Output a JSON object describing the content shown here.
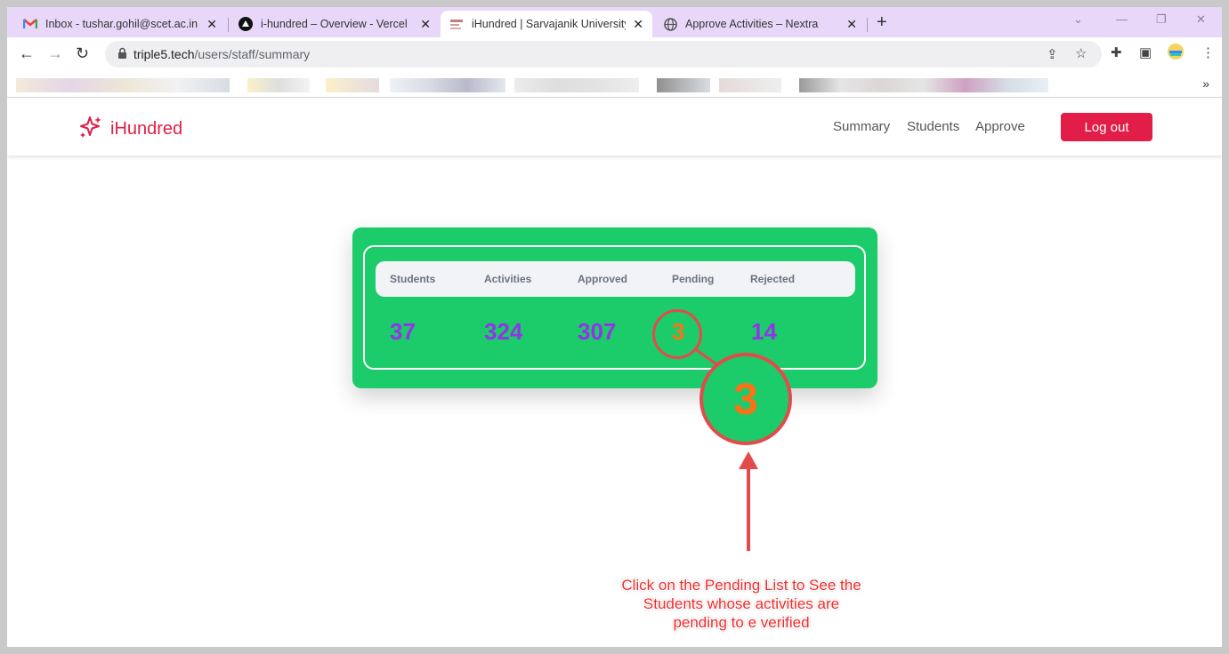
{
  "browser": {
    "tabs": [
      {
        "title": "Inbox - tushar.gohil@scet.ac.in -",
        "icon": "gmail-icon"
      },
      {
        "title": "i-hundred – Overview - Vercel",
        "icon": "vercel-icon"
      },
      {
        "title": "iHundred | Sarvajanik University",
        "icon": "site-favicon"
      },
      {
        "title": "Approve Activities – Nextra",
        "icon": "globe-icon"
      }
    ],
    "active_tab_index": 2,
    "url_host": "triple5.tech",
    "url_path": "/users/staff/summary",
    "bookmarks_more": "»"
  },
  "site": {
    "brand": "iHundred",
    "nav": {
      "summary": "Summary",
      "students": "Students",
      "approve": "Approve"
    },
    "logout_label": "Log out",
    "brand_color": "#e11d48"
  },
  "summary": {
    "headers": {
      "students": "Students",
      "activities": "Activities",
      "approved": "Approved",
      "pending": "Pending",
      "rejected": "Rejected"
    },
    "values": {
      "students": "37",
      "activities": "324",
      "approved": "307",
      "pending": "3",
      "rejected": "14"
    },
    "card_color": "#1ccb69",
    "value_color": "#9333ea",
    "pending_color": "#f97316"
  },
  "annotation": {
    "zoom_value": "3",
    "callout_lines": [
      "Click on the Pending List to See the",
      "Students whose activities are",
      "pending to e verified"
    ],
    "color": "#e34b4b"
  }
}
